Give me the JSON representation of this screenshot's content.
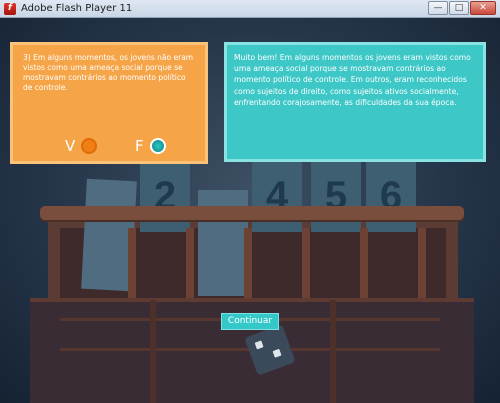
{
  "window": {
    "title": "Adobe Flash Player 11",
    "controls": [
      "—",
      "□",
      "✕"
    ]
  },
  "question": {
    "text": "3) Em alguns momentos, os jovens não eram vistos como uma ameaça social porque se mostravam contrários ao momento político de controle.",
    "options": [
      {
        "label": "V",
        "selected": false
      },
      {
        "label": "F",
        "selected": true
      }
    ]
  },
  "feedback": {
    "text": "Muito bem! Em alguns momentos os jovens eram vistos como uma ameaça social porque se mostravam contrários ao momento político de controle. Em outros, eram reconhecidos como sujeitos de direito, como sujeitos ativos socialmente, enfrentando corajosamente, as dificuldades da sua época."
  },
  "cards": [
    "",
    "2",
    "",
    "4",
    "5",
    "6"
  ],
  "continue_label": "Continuar",
  "colors": {
    "question_panel": "#f5a447",
    "feedback_panel": "#3ec7c7",
    "selected_radio": "#1a9ea0"
  }
}
